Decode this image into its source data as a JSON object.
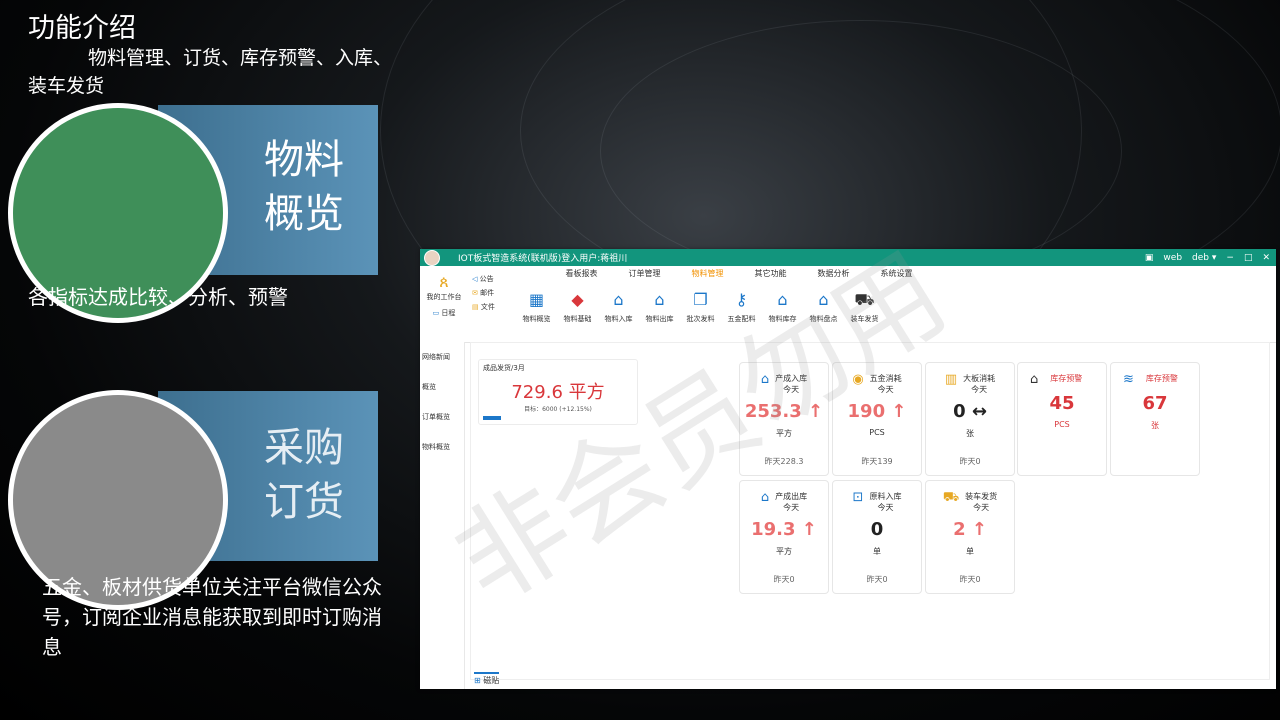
{
  "intro": {
    "title": "功能介绍",
    "text": "物料管理、订货、库存预警、入库、装车发货"
  },
  "section1": {
    "label_line1": "物料",
    "label_line2": "概览",
    "desc": "各指标达成比较、分析、预警"
  },
  "section2": {
    "label_line1": "采购",
    "label_line2": "订货",
    "desc": "五金、板材供货单位关注平台微信公众号，订阅企业消息能获取到即时订购消息"
  },
  "watermark": "非会员勿用",
  "app": {
    "title": "IOT板式智造系统(联机版)登入用户:蒋祖川",
    "titlebar_right": {
      "web": "web",
      "user": "deb ▾",
      "minimize": "−",
      "maximize": "□",
      "close": "✕"
    },
    "left_tiles": {
      "my_task": "我的工作台",
      "notice": "公告",
      "mail": "邮件",
      "schedule": "日程",
      "file": "文件"
    },
    "tabs": [
      "看板报表",
      "订单管理",
      "物料管理",
      "其它功能",
      "数据分析",
      "系统设置"
    ],
    "active_tab": "物料管理",
    "tools": [
      {
        "label": "物料概览",
        "icon": "grid-icon"
      },
      {
        "label": "物料基础",
        "icon": "box-icon"
      },
      {
        "label": "物料入库",
        "icon": "warehouse-in-icon"
      },
      {
        "label": "物料出库",
        "icon": "warehouse-out-icon"
      },
      {
        "label": "批次发料",
        "icon": "batch-icon"
      },
      {
        "label": "五金配料",
        "icon": "hardware-icon"
      },
      {
        "label": "物料库存",
        "icon": "stock-icon"
      },
      {
        "label": "物料盘点",
        "icon": "inventory-icon"
      },
      {
        "label": "装车发货",
        "icon": "truck-icon"
      }
    ],
    "sidebar": [
      "网络新闻",
      "概览",
      "订单概览",
      "物料概览"
    ],
    "bottom_tab": "磁贴",
    "summary": {
      "label": "成品发货/3月",
      "value": "729.6 平方",
      "target": "目标：6000 (+12.15%)"
    },
    "cards": [
      {
        "title": "产成入库",
        "sub": "今天",
        "value": "253.3 ↑",
        "unit": "平方",
        "yesterday": "昨天228.3",
        "icon": "house-icon"
      },
      {
        "title": "五金消耗",
        "sub": "今天",
        "value": "190 ↑",
        "unit": "PCS",
        "yesterday": "昨天139",
        "icon": "coin-icon"
      },
      {
        "title": "大板消耗",
        "sub": "今天",
        "value": "0 ↔",
        "unit": "张",
        "yesterday": "昨天0",
        "icon": "board-icon"
      },
      {
        "title": "库存预警",
        "value": "45",
        "unit": "PCS",
        "icon": "store-icon"
      },
      {
        "title": "库存预警",
        "value": "67",
        "unit": "张",
        "icon": "layers-icon"
      },
      {
        "title": "产成出库",
        "sub": "今天",
        "value": "19.3 ↑",
        "unit": "平方",
        "yesterday": "昨天0",
        "icon": "box-out-icon"
      },
      {
        "title": "原料入库",
        "sub": "今天",
        "value": "0",
        "unit": "单",
        "yesterday": "昨天0",
        "icon": "material-in-icon"
      },
      {
        "title": "装车发货",
        "sub": "今天",
        "value": "2 ↑",
        "unit": "单",
        "yesterday": "昨天0",
        "icon": "truck-icon"
      }
    ]
  }
}
